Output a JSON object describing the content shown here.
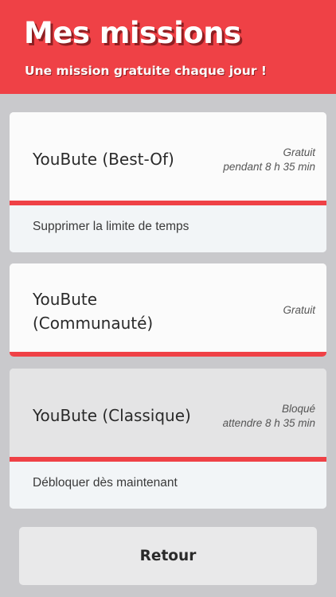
{
  "header": {
    "title": "Mes missions",
    "subtitle": "Une mission gratuite chaque jour !"
  },
  "missions": [
    {
      "name": "YouBute (Best-Of)",
      "status_line1": "Gratuit",
      "status_line2": "pendant 8 h 35 min",
      "action": "Supprimer la limite de temps",
      "locked": false
    },
    {
      "name_line1": "YouBute",
      "name_line2": "(Communauté)",
      "status_line1": "Gratuit",
      "locked": false
    },
    {
      "name": "YouBute (Classique)",
      "status_line1": "Bloqué",
      "status_line2": "attendre 8 h 35 min",
      "action": "Débloquer dès maintenant",
      "locked": true
    }
  ],
  "footer": {
    "back_label": "Retour"
  },
  "colors": {
    "accent_red": "#ef4146",
    "background_gray": "#c9c9cc",
    "card_white": "#fbfbfb",
    "locked_card_gray": "#e4e4e5"
  }
}
